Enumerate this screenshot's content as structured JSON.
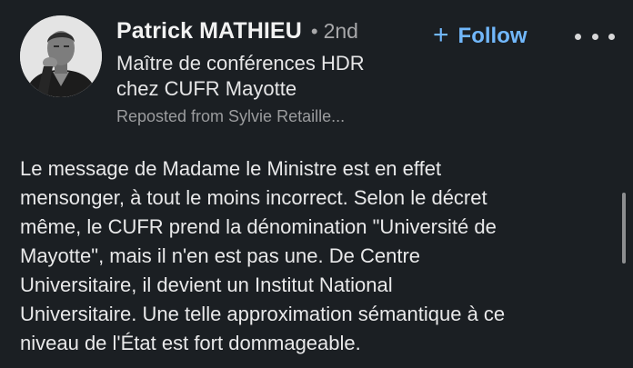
{
  "author": {
    "name": "Patrick MATHIEU",
    "separator": "•",
    "degree": "2nd",
    "headline_lines": [
      "Maître de conférences HDR",
      "chez CUFR Mayotte"
    ],
    "reposted": "Reposted from Sylvie Retaille..."
  },
  "actions": {
    "follow_icon": "+",
    "follow_label": "Follow",
    "more_icon": "more-horizontal-icon"
  },
  "post": {
    "lines": [
      "Le message de Madame le Ministre est en effet",
      "mensonger, à tout le moins incorrect. Selon le décret",
      "même, le CUFR prend la dénomination \"Université de",
      "Mayotte\", mais il n'en est pas une. De Centre",
      "Universitaire, il devient un Institut National",
      "Universitaire. Une telle approximation sémantique à ce",
      "niveau de l'État est fort dommageable."
    ]
  },
  "colors": {
    "background": "#1b1f23",
    "accent": "#71b7fb",
    "muted": "#9b9c9e"
  }
}
